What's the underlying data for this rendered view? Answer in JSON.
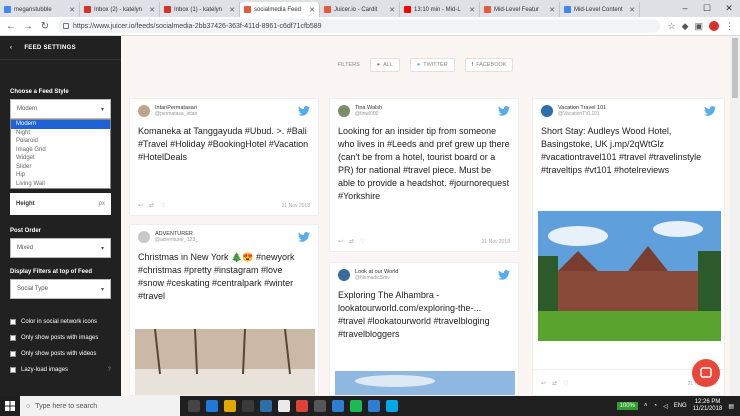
{
  "browser": {
    "tabs": [
      {
        "title": "meganstubble",
        "color": "#4285f4"
      },
      {
        "title": "Inbox (2) - katelyn",
        "color": "#d93025"
      },
      {
        "title": "Inbox (1) - katelyn",
        "color": "#d93025"
      },
      {
        "title": "socialmedia Feed",
        "color": "#e8583b",
        "active": true
      },
      {
        "title": "Juicer.io - Cardit",
        "color": "#e8583b"
      },
      {
        "title": "13:10 min - Mid-L",
        "color": "#ff0000"
      },
      {
        "title": "Mid-Level Featur",
        "color": "#e8583b"
      },
      {
        "title": "Mid-Level Content",
        "color": "#4285f4"
      }
    ],
    "url": "https://www.juicer.io/feeds/socialmedia-2bb37426-363f-411d-8961-c6df71cfb589"
  },
  "sidebar": {
    "title": "FEED SETTINGS",
    "feed_style_label": "Choose a Feed Style",
    "feed_style_value": "Modern",
    "feed_style_options": [
      "Modern",
      "Night",
      "Polaroid",
      "Image Grid",
      "Widget",
      "Slider",
      "Hip",
      "Living Wall"
    ],
    "height_label": "Height",
    "height_unit": "px",
    "post_order_label": "Post Order",
    "post_order_value": "Mixed",
    "filters_label": "Display Filters at top of Feed",
    "filters_value": "Social Type",
    "checkboxes": [
      "Color in social network icons",
      "Only show posts with images",
      "Only show posts with videos",
      "Lazy-load images"
    ],
    "help": "?"
  },
  "filters": {
    "label": "FILTERS",
    "all": "ALL",
    "twitter": "TWITTER",
    "facebook": "FACEBOOK"
  },
  "posts": [
    {
      "name": "IntanPermatasari",
      "handle": "@permatasa_intan",
      "text": "Komaneka at Tanggayuda #Ubud. >. #Bali #Travel #Holiday #BookingHotel #Vacation #HotelDeals",
      "date": "21 Nov 2018",
      "avatar": "#bfa68a"
    },
    {
      "name": "Tina Walsh",
      "handle": "@tinwl000",
      "text": "Looking for an insider tip from someone who lives in #Leeds and pref grew up there (can't be from a hotel, tourist board or a PR) for national #travel piece. Must be able to provide a headshot. #journorequest #Yorkshire",
      "date": "21 Nov 2018",
      "avatar": "#7a8c6a"
    },
    {
      "name": "Vacation Travel 101",
      "handle": "@VacationTVL101",
      "text": "Short Stay: Audleys Wood Hotel, Basingstoke, UK j.mp/2qWtGlz #vacationtravel101 #travel #travelinstyle #traveltips #vt101 #hotelreviews",
      "date": "",
      "avatar": "#2b6fa8"
    },
    {
      "name": "ADVENTURER",
      "handle": "@adventurer_123_",
      "text": "Christmas in New York 🎄😍 #newyork #christmas #pretty #instagram #love #snow #ceskating #centralpark #winter #travel",
      "date": "",
      "avatar": "#c8c8c8"
    },
    {
      "name": "Look at our World",
      "handle": "@NomadicSmv",
      "text": "Exploring The Alhambra - lookatourworld.com/exploring-the-... #travel #lookatourworld #travelbloging #travelbloggers",
      "date": "",
      "avatar": "#3a6a9a"
    }
  ],
  "last_date": "21 Nov 2018",
  "taskbar": {
    "search": "Type here to search",
    "battery": "100%",
    "lang": "ENG",
    "time": "12:26 PM",
    "date": "11/21/2018"
  }
}
